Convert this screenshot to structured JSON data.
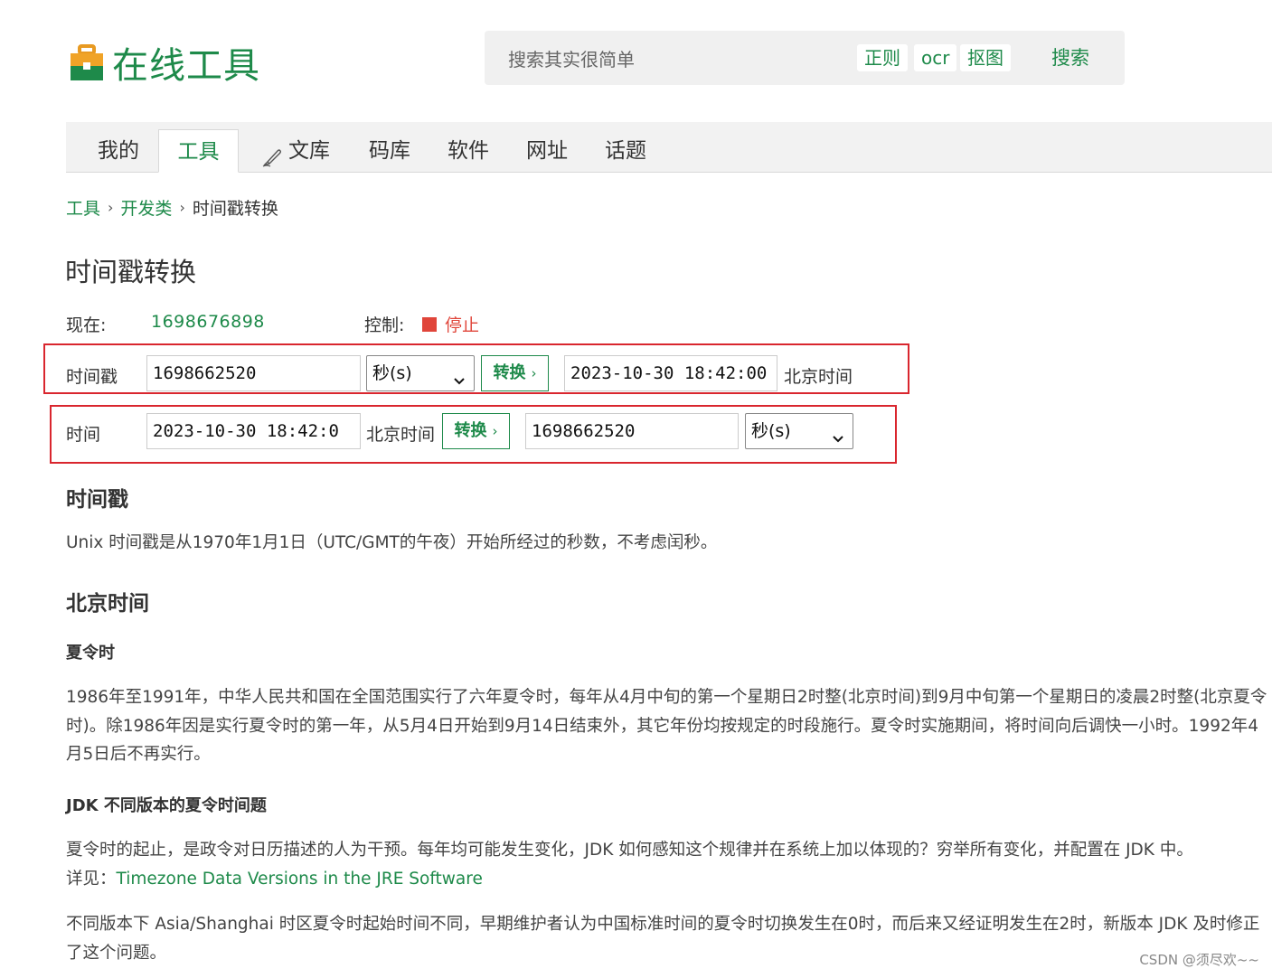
{
  "header": {
    "logo_text": "在线工具",
    "search_placeholder": "搜索其实很简单",
    "quick_links": [
      "正则",
      "ocr",
      "抠图"
    ],
    "search_button": "搜索"
  },
  "nav": {
    "items": [
      "我的",
      "工具",
      "文库",
      "码库",
      "软件",
      "网址",
      "话题"
    ],
    "active": "工具"
  },
  "breadcrumb": {
    "items": [
      "工具",
      "开发类"
    ],
    "current": "时间戳转换"
  },
  "page_title": "时间戳转换",
  "status": {
    "now_label": "现在:",
    "now_value": "1698676898",
    "control_label": "控制:",
    "stop_label": "停止"
  },
  "row_timestamp": {
    "label": "时间戳",
    "input_value": "1698662520",
    "unit": "秒(s)",
    "convert_button": "转换",
    "result_value": "2023-10-30 18:42:00",
    "result_suffix": "北京时间"
  },
  "row_time": {
    "label": "时间",
    "input_value": "2023-10-30 18:42:0",
    "input_suffix": "北京时间",
    "convert_button": "转换",
    "result_value": "1698662520",
    "unit": "秒(s)"
  },
  "content": {
    "h_timestamp": "时间戳",
    "p_timestamp": "Unix 时间戳是从1970年1月1日（UTC/GMT的午夜）开始所经过的秒数，不考虑闰秒。",
    "h_beijing": "北京时间",
    "h_dst": "夏令时",
    "p_dst": "1986年至1991年，中华人民共和国在全国范围实行了六年夏令时，每年从4月中旬的第一个星期日2时整(北京时间)到9月中旬第一个星期日的凌晨2时整(北京夏令时)。除1986年因是实行夏令时的第一年，从5月4日开始到9月14日结束外，其它年份均按规定的时段施行。夏令时实施期间，将时间向后调快一小时。1992年4月5日后不再实行。",
    "h_jdk": "JDK 不同版本的夏令时间题",
    "p_jdk_1": "夏令时的起止，是政令对日历描述的人为干预。每年均可能发生变化，JDK 如何感知这个规律并在系统上加以体现的？穷举所有变化，并配置在 JDK 中。",
    "p_jdk_see": "详见：",
    "p_jdk_link": "Timezone Data Versions in the JRE Software",
    "p_jdk_2": "不同版本下 Asia/Shanghai 时区夏令时起始时间不同，早期维护者认为中国标准时间的夏令时切换发生在0时，而后来又经证明发生在2时，新版本 JDK 及时修正了这个问题。"
  },
  "watermark": "CSDN @须尽欢~~",
  "colors": {
    "brand_green": "#1e8a4a",
    "highlight_red": "#d9262e",
    "stop_red": "#e0453a"
  }
}
